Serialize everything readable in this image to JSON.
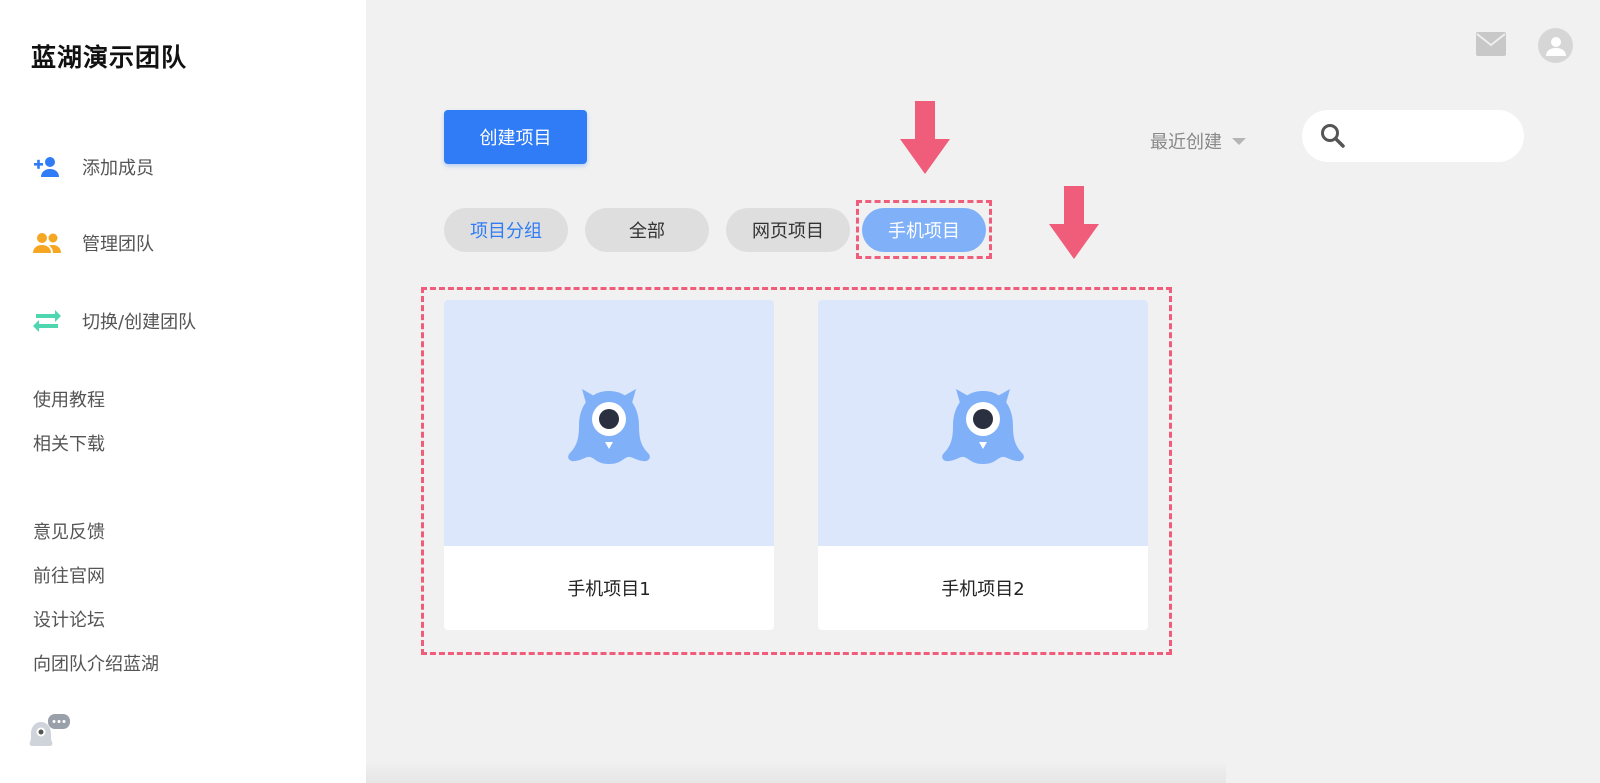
{
  "sidebar": {
    "team_name": "蓝湖演示团队",
    "menu": [
      {
        "label": "添加成员",
        "icon": "add-user-icon",
        "color": "#2f7cf6"
      },
      {
        "label": "管理团队",
        "icon": "team-icon",
        "color": "#f5a623"
      },
      {
        "label": "切换/创建团队",
        "icon": "switch-icon",
        "color": "#4dd6b0"
      }
    ],
    "links_top": [
      "使用教程",
      "相关下载"
    ],
    "links_bottom": [
      "意见反馈",
      "前往官网",
      "设计论坛",
      "向团队介绍蓝湖"
    ]
  },
  "toolbar": {
    "create_label": "创建项目",
    "sort_label": "最近创建",
    "search_placeholder": ""
  },
  "filters": {
    "items": [
      "项目分组",
      "全部",
      "网页项目",
      "手机项目"
    ],
    "active": "手机项目"
  },
  "projects": [
    {
      "name": "手机项目1"
    },
    {
      "name": "手机项目2"
    }
  ],
  "colors": {
    "accent": "#2f7cf6",
    "highlight": "#f05d7a",
    "thumb_bg": "#dce7fb",
    "mascot": "#7fb0f8"
  }
}
